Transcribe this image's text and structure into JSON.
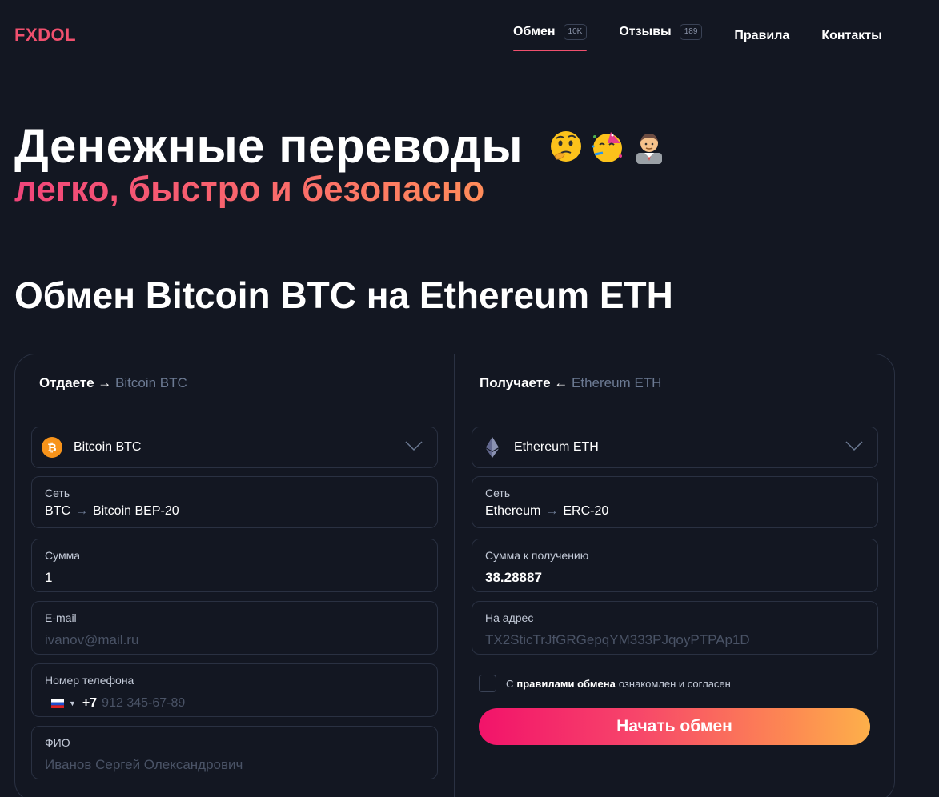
{
  "header": {
    "logo": "FXDOL",
    "nav": [
      {
        "label": "Обмен",
        "badge": "10K"
      },
      {
        "label": "Отзывы",
        "badge": "189"
      },
      {
        "label": "Правила"
      },
      {
        "label": "Контакты"
      }
    ]
  },
  "hero": {
    "title": "Денежные переводы",
    "subtitle": "легко, быстро и безопасно",
    "emojis": [
      "thinking-face-icon",
      "partying-face-icon",
      "office-worker-icon"
    ]
  },
  "exchange": {
    "title": "Обмен Bitcoin BTC на Ethereum ETH",
    "left": {
      "head_label": "Отдаете →",
      "head_currency": "Bitcoin BTC",
      "currency": "Bitcoin BTC",
      "network_label": "Сеть",
      "network_from": "BTC",
      "network_to": "Bitcoin BEP-20",
      "amount_label": "Сумма",
      "amount_value": "1",
      "email_label": "E-mail",
      "email_placeholder": "ivanov@mail.ru",
      "phone_label": "Номер телефона",
      "phone_code": "+7",
      "phone_placeholder": "912 345-67-89",
      "fio_label": "ФИО",
      "fio_placeholder": "Иванов Сергей Олександрович"
    },
    "right": {
      "head_label": "Получаете ←",
      "head_currency": "Ethereum ETH",
      "currency": "Ethereum ETH",
      "network_label": "Сеть",
      "network_from": "Ethereum",
      "network_to": "ERC-20",
      "receive_label": "Сумма к получению",
      "receive_value": "38.28887",
      "address_label": "На адрес",
      "address_placeholder": "TX2SticTrJfGRGepqYM333PJqoyPTPAp1D"
    },
    "agree": {
      "prefix": "С",
      "rules": "правилами обмена",
      "suffix": "ознакомлен и согласен"
    },
    "start_button": "Начать обмен"
  },
  "colors": {
    "background": "#131722",
    "accent": "#f0506e",
    "border": "#2a3142",
    "muted": "#6c7a93",
    "bitcoin": "#f7931a"
  }
}
